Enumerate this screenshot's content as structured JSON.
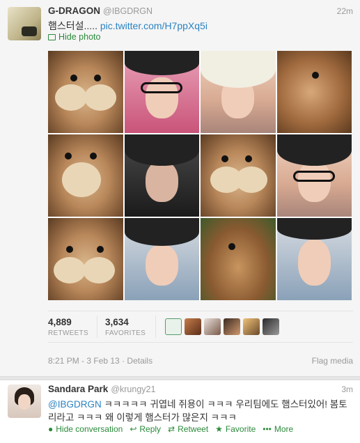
{
  "tweet1": {
    "name": "G-DRAGON",
    "handle": "@IBGDRGN",
    "time": "22m",
    "text": "햄스터설..... ",
    "link": "pic.twitter.com/H7ppXq5i",
    "hide_photo": "Hide photo",
    "photo_icon": "photo-icon",
    "stats": {
      "retweets_count": "4,889",
      "retweets_label": "RETWEETS",
      "favorites_count": "3,634",
      "favorites_label": "FAVORITES"
    },
    "timestamp": "8:21 PM - 3 Feb 13",
    "details": "Details",
    "flag_media": "Flag media"
  },
  "tweet2": {
    "name": "Sandara Park",
    "handle": "@krungy21",
    "time": "3m",
    "mention": "@IBGDRGN",
    "text": " ㅋㅋㅋㅋㅋ 귀엽네 쥐용이 ㅋㅋㅋ 우리팀에도 햄스터있어! 봄토리라고 ㅋㅋㅋ 왜 이렇게 햄스터가 많은지 ㅋㅋㅋ",
    "actions": {
      "hide_conversation": "Hide conversation",
      "reply": "Reply",
      "retweet": "Retweet",
      "favorite": "Favorite",
      "more": "More"
    }
  },
  "colors": {
    "link": "#2a83c3",
    "action": "#2a8a3a",
    "muted": "#999999"
  }
}
